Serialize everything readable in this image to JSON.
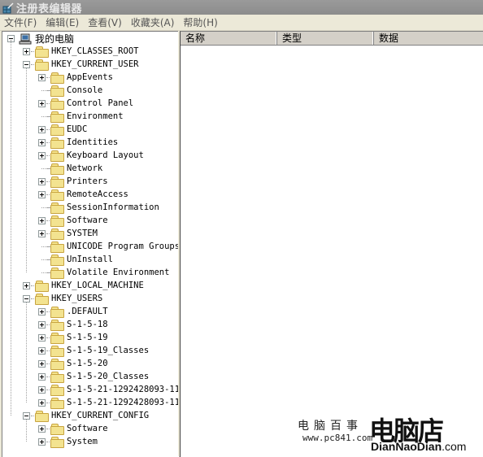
{
  "window": {
    "title": "注册表编辑器"
  },
  "menu": [
    {
      "label": "文件(F)"
    },
    {
      "label": "编辑(E)"
    },
    {
      "label": "查看(V)"
    },
    {
      "label": "收藏夹(A)"
    },
    {
      "label": "帮助(H)"
    }
  ],
  "list": {
    "columns": [
      {
        "label": "名称"
      },
      {
        "label": "类型"
      },
      {
        "label": "数据"
      }
    ]
  },
  "tree": {
    "root": {
      "label": "我的电脑",
      "expanded": true
    },
    "nodes": [
      {
        "label": "HKEY_CLASSES_ROOT",
        "level": 1,
        "expander": "plus"
      },
      {
        "label": "HKEY_CURRENT_USER",
        "level": 1,
        "expander": "minus"
      },
      {
        "label": "AppEvents",
        "level": 2,
        "expander": "plus"
      },
      {
        "label": "Console",
        "level": 2,
        "expander": "none"
      },
      {
        "label": "Control Panel",
        "level": 2,
        "expander": "plus"
      },
      {
        "label": "Environment",
        "level": 2,
        "expander": "none"
      },
      {
        "label": "EUDC",
        "level": 2,
        "expander": "plus"
      },
      {
        "label": "Identities",
        "level": 2,
        "expander": "plus"
      },
      {
        "label": "Keyboard Layout",
        "level": 2,
        "expander": "plus"
      },
      {
        "label": "Network",
        "level": 2,
        "expander": "none"
      },
      {
        "label": "Printers",
        "level": 2,
        "expander": "plus"
      },
      {
        "label": "RemoteAccess",
        "level": 2,
        "expander": "plus"
      },
      {
        "label": "SessionInformation",
        "level": 2,
        "expander": "none"
      },
      {
        "label": "Software",
        "level": 2,
        "expander": "plus"
      },
      {
        "label": "SYSTEM",
        "level": 2,
        "expander": "plus"
      },
      {
        "label": "UNICODE Program Groups",
        "level": 2,
        "expander": "none"
      },
      {
        "label": "UnInstall",
        "level": 2,
        "expander": "none"
      },
      {
        "label": "Volatile Environment",
        "level": 2,
        "expander": "none"
      },
      {
        "label": "HKEY_LOCAL_MACHINE",
        "level": 1,
        "expander": "plus"
      },
      {
        "label": "HKEY_USERS",
        "level": 1,
        "expander": "minus"
      },
      {
        "label": ".DEFAULT",
        "level": 2,
        "expander": "plus"
      },
      {
        "label": "S-1-5-18",
        "level": 2,
        "expander": "plus"
      },
      {
        "label": "S-1-5-19",
        "level": 2,
        "expander": "plus"
      },
      {
        "label": "S-1-5-19_Classes",
        "level": 2,
        "expander": "plus"
      },
      {
        "label": "S-1-5-20",
        "level": 2,
        "expander": "plus"
      },
      {
        "label": "S-1-5-20_Classes",
        "level": 2,
        "expander": "plus"
      },
      {
        "label": "S-1-5-21-1292428093-11",
        "level": 2,
        "expander": "plus"
      },
      {
        "label": "S-1-5-21-1292428093-11",
        "level": 2,
        "expander": "plus"
      },
      {
        "label": "HKEY_CURRENT_CONFIG",
        "level": 1,
        "expander": "minus"
      },
      {
        "label": "Software",
        "level": 2,
        "expander": "plus"
      },
      {
        "label": "System",
        "level": 2,
        "expander": "plus"
      }
    ]
  },
  "watermark": {
    "site_name": "电脑百事",
    "site_url": "www.pc841.com",
    "logo_text": "电脑店",
    "logo_brand": "DianNaoDian",
    "logo_tld": ".com"
  }
}
